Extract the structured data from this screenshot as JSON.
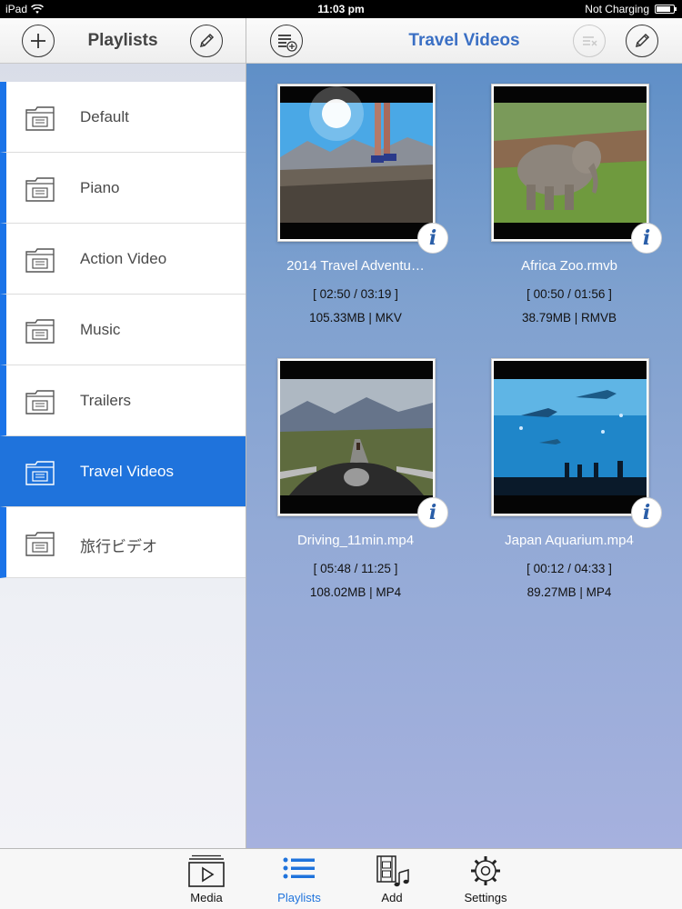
{
  "status_bar": {
    "device": "iPad",
    "time": "11:03 pm",
    "charging": "Not Charging"
  },
  "sidebar_header": {
    "title": "Playlists",
    "add_icon": "plus-circle-icon",
    "edit_icon": "pencil-icon"
  },
  "main_header": {
    "title": "Travel Videos",
    "add_to_playlist_icon": "list-add-icon",
    "clear_icon": "list-clear-icon",
    "edit_icon": "pencil-icon"
  },
  "playlists": [
    {
      "label": "Default",
      "active": false
    },
    {
      "label": "Piano",
      "active": false
    },
    {
      "label": "Action Video",
      "active": false
    },
    {
      "label": "Music",
      "active": false
    },
    {
      "label": "Trailers",
      "active": false
    },
    {
      "label": "Travel Videos",
      "active": true
    },
    {
      "label": "旅行ビデオ",
      "active": false
    }
  ],
  "videos": [
    {
      "title": "2014 Travel Adventu…",
      "time": "[ 02:50  / 03:19 ]",
      "size": "105.33MB | MKV"
    },
    {
      "title": "Africa Zoo.rmvb",
      "time": "[ 00:50  / 01:56 ]",
      "size": "38.79MB | RMVB"
    },
    {
      "title": "Driving_11min.mp4",
      "time": "[ 05:48  / 11:25 ]",
      "size": "108.02MB | MP4"
    },
    {
      "title": "Japan Aquarium.mp4",
      "time": "[ 00:12  / 04:33 ]",
      "size": "89.27MB | MP4"
    }
  ],
  "tabs": [
    {
      "label": "Media",
      "icon": "media-play-icon",
      "active": false
    },
    {
      "label": "Playlists",
      "icon": "list-icon",
      "active": true
    },
    {
      "label": "Add",
      "icon": "film-music-icon",
      "active": false
    },
    {
      "label": "Settings",
      "icon": "gear-icon",
      "active": false
    }
  ],
  "colors": {
    "accent": "#1f73dc",
    "header_title": "#3a6fc4"
  }
}
